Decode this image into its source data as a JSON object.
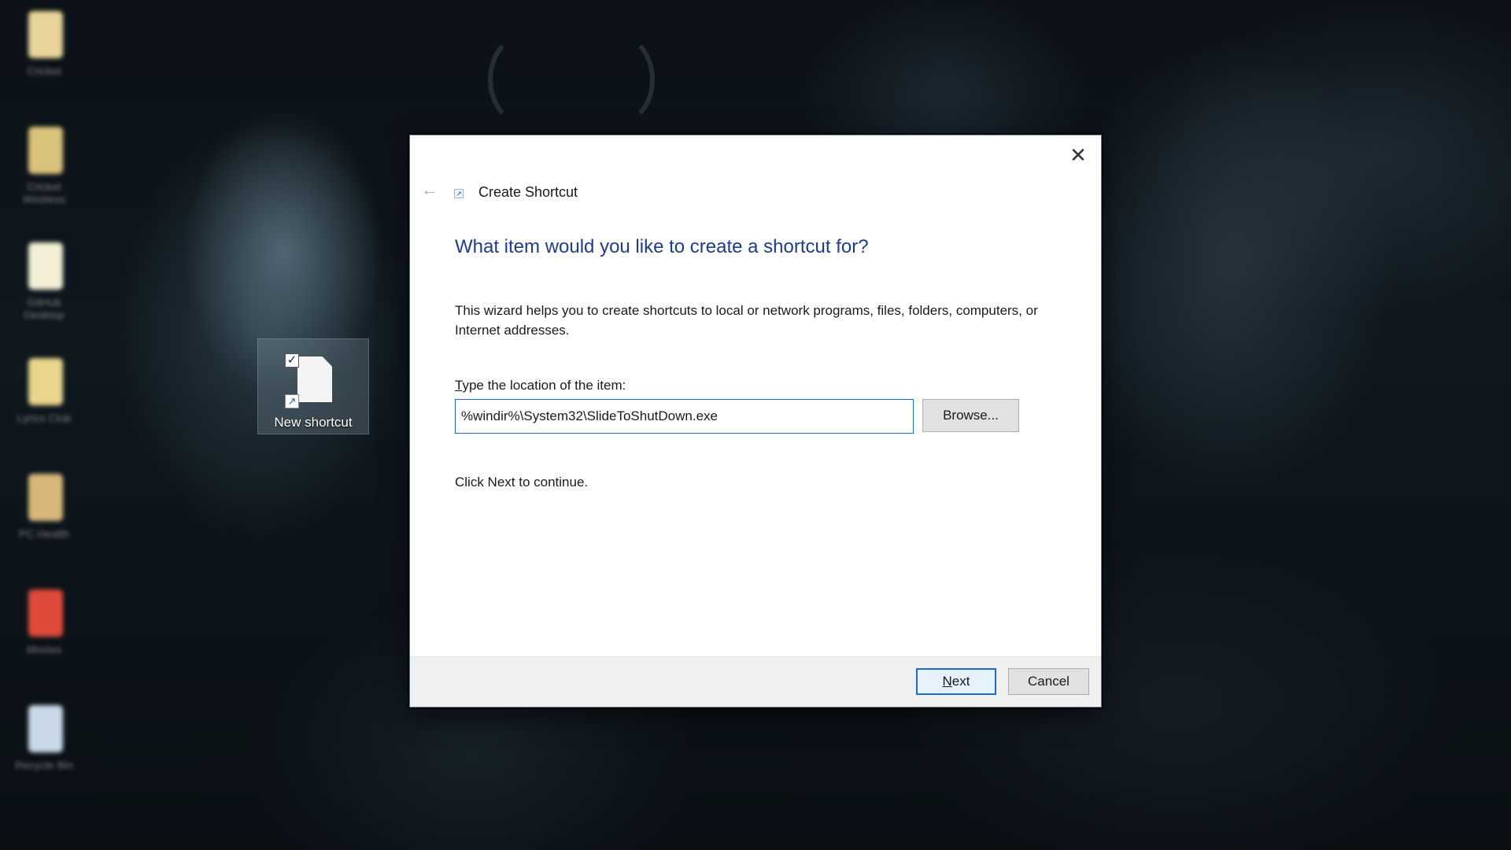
{
  "desktop": {
    "icons": [
      {
        "label": "Cricket",
        "color": "#e8d49a"
      },
      {
        "label": "Cricket Wireless",
        "color": "#d9c27a"
      },
      {
        "label": "GitHub Desktop",
        "color": "#f2efd6"
      },
      {
        "label": "Lyrics Club",
        "color": "#e9d58c"
      },
      {
        "label": "PC Health",
        "color": "#d8b87a"
      },
      {
        "label": "Movies",
        "color": "#e04a3a"
      },
      {
        "label": "Recycle Bin",
        "color": "#c9d9e8"
      }
    ],
    "new_shortcut": {
      "label": "New shortcut",
      "check_glyph": "✓",
      "arrow_glyph": "↗"
    }
  },
  "dialog": {
    "title": "Create Shortcut",
    "close_glyph": "✕",
    "back_glyph": "←",
    "title_icon_glyph": "↗",
    "heading": "What item would you like to create a shortcut for?",
    "description": "This wizard helps you to create shortcuts to local or network programs, files, folders, computers, or Internet addresses.",
    "location_label": "Type the location of the item:",
    "location_value": "%windir%\\System32\\SlideToShutDown.exe",
    "browse_label": "Browse...",
    "continue_text": "Click Next to continue.",
    "next_label": "Next",
    "cancel_label": "Cancel",
    "accent_color": "#1c6ad0",
    "heading_color": "#1c3c8c"
  }
}
